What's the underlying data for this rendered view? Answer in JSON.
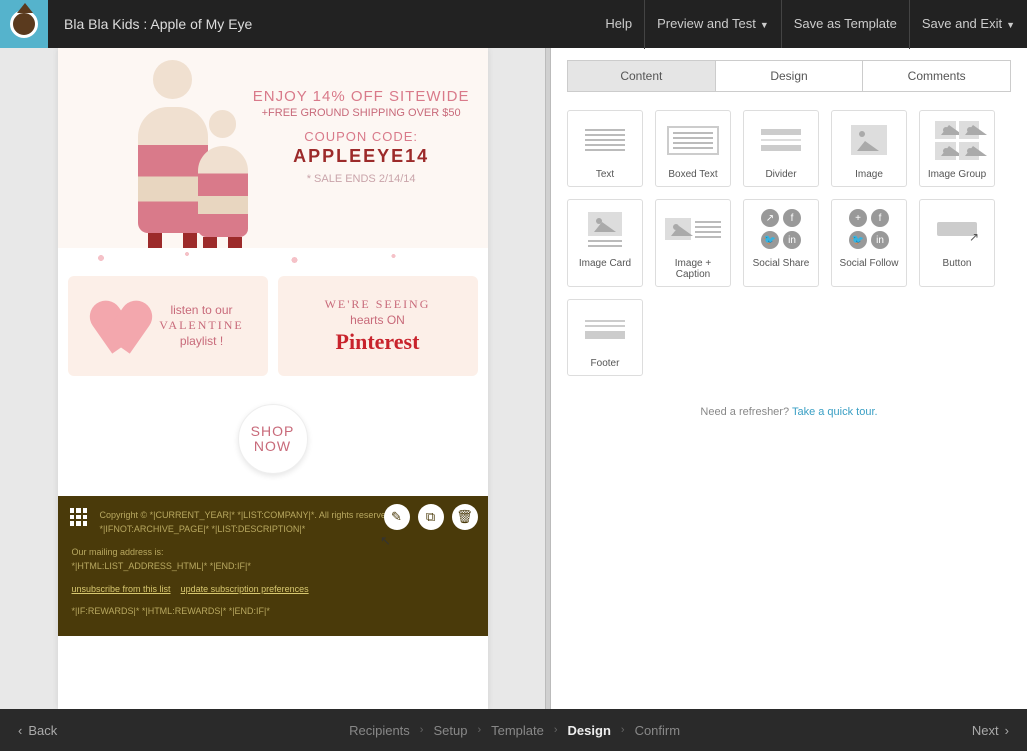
{
  "header": {
    "title": "Bla Bla Kids : Apple of My Eye",
    "help": "Help",
    "preview": "Preview and Test",
    "save_template": "Save as Template",
    "save_exit": "Save and Exit"
  },
  "promo": {
    "line1": "ENJOY 14% OFF SITEWIDE",
    "line2": "+FREE GROUND SHIPPING OVER $50",
    "line3": "COUPON CODE:",
    "code": "APPLEEYE14",
    "ends": "* SALE ENDS 2/14/14"
  },
  "card_left": {
    "l1": "listen to our",
    "l2": "VALENTINE",
    "l3": "playlist !"
  },
  "card_right": {
    "l1": "WE'RE SEEING",
    "l2": "hearts ON",
    "brand": "Pinterest"
  },
  "shop": {
    "l1": "SHOP",
    "l2": "NOW"
  },
  "email_footer": {
    "l1": "Copyright © *|CURRENT_YEAR|* *|LIST:COMPANY|*. All rights reserved.",
    "l2": "*|IFNOT:ARCHIVE_PAGE|* *|LIST:DESCRIPTION|*",
    "l3": "Our mailing address is:",
    "l4": "*|HTML:LIST_ADDRESS_HTML|* *|END:IF|*",
    "l5a": "unsubscribe from this list",
    "l5b": "update subscription preferences",
    "l6": "*|IF:REWARDS|* *|HTML:REWARDS|* *|END:IF|*"
  },
  "tabs": {
    "content": "Content",
    "design": "Design",
    "comments": "Comments"
  },
  "blocks": {
    "text": "Text",
    "boxed": "Boxed Text",
    "divider": "Divider",
    "image": "Image",
    "imagegroup": "Image Group",
    "imagecard": "Image Card",
    "imagecaption": "Image + Caption",
    "socialshare": "Social Share",
    "socialfollow": "Social Follow",
    "button": "Button",
    "footer": "Footer"
  },
  "refresher": {
    "q": "Need a refresher? ",
    "link": "Take a quick tour."
  },
  "steps": {
    "back": "Back",
    "next": "Next",
    "s1": "Recipients",
    "s2": "Setup",
    "s3": "Template",
    "s4": "Design",
    "s5": "Confirm"
  }
}
